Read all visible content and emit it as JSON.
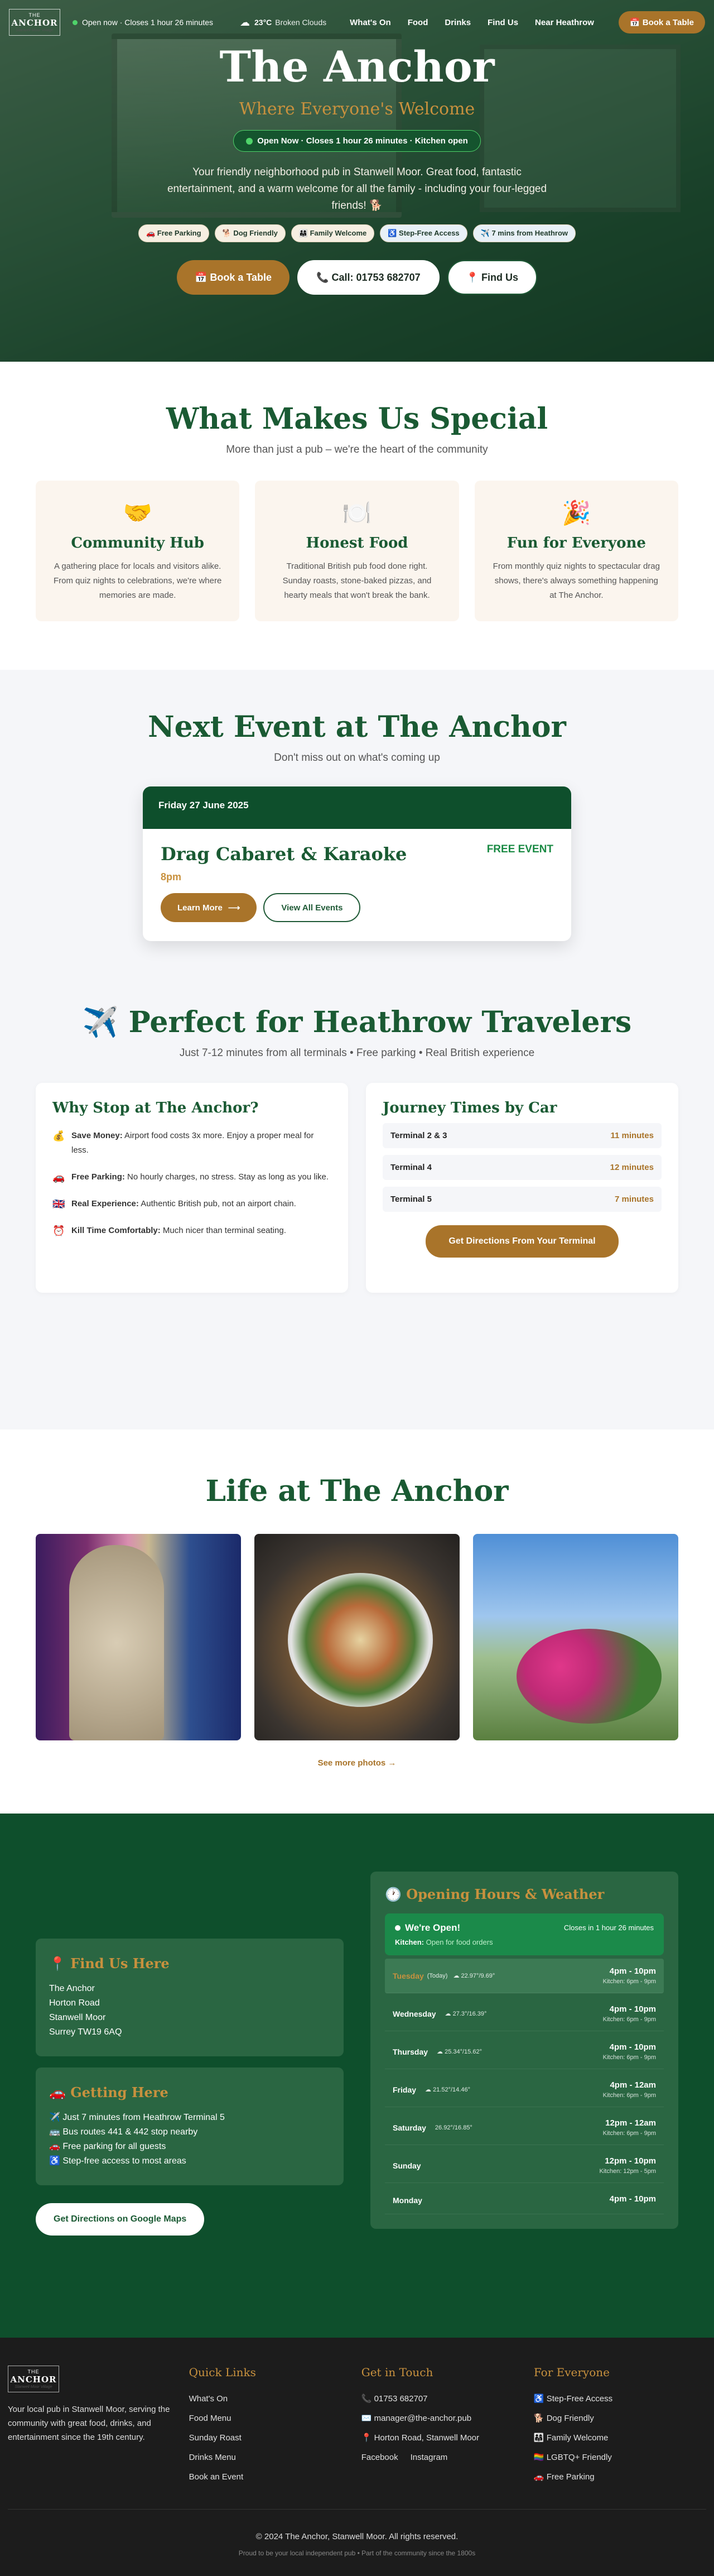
{
  "nav": {
    "logo_top": "THE",
    "logo_name": "ANCHOR",
    "logo_sub": "Stanwell Moor Village",
    "status": "Open now · Closes 1 hour 26 minutes",
    "weather_temp": "23°C",
    "weather_desc": "Broken Clouds",
    "links": [
      "What's On",
      "Food",
      "Drinks",
      "Find Us",
      "Near Heathrow"
    ],
    "book": "📅 Book a Table"
  },
  "hero": {
    "title": "The Anchor",
    "tagline": "Where Everyone's Welcome",
    "status_pill": "Open Now · Closes 1 hour 26 minutes · Kitchen open",
    "intro": "Your friendly neighborhood pub in Stanwell Moor. Great food, fantastic entertainment, and a warm welcome for all the family - including your four-legged friends! 🐕",
    "badges": [
      "🚗 Free Parking",
      "🐕 Dog Friendly",
      "👨‍👩‍👧 Family Welcome",
      "♿ Step-Free Access",
      "✈️ 7 mins from Heathrow"
    ],
    "cta_book": "📅 Book a Table",
    "cta_call": "📞 Call: 01753 682707",
    "cta_find": "📍 Find Us"
  },
  "special": {
    "title": "What Makes Us Special",
    "subtitle": "More than just a pub – we're the heart of the community",
    "cards": [
      {
        "icon": "🤝",
        "title": "Community Hub",
        "text": "A gathering place for locals and visitors alike. From quiz nights to celebrations, we're where memories are made."
      },
      {
        "icon": "🍽️",
        "title": "Honest Food",
        "text": "Traditional British pub food done right. Sunday roasts, stone-baked pizzas, and hearty meals that won't break the bank."
      },
      {
        "icon": "🎉",
        "title": "Fun for Everyone",
        "text": "From monthly quiz nights to spectacular drag shows, there's always something happening at The Anchor."
      }
    ]
  },
  "event": {
    "title": "Next Event at The Anchor",
    "subtitle": "Don't miss out on what's coming up",
    "date": "Friday 27 June 2025",
    "name": "Drag Cabaret & Karaoke",
    "time": "8pm",
    "price": "FREE EVENT",
    "learn": "Learn More",
    "all": "View All Events"
  },
  "heathrow": {
    "title": "✈️ Perfect for Heathrow Travelers",
    "subtitle": "Just 7-12 minutes from all terminals • Free parking • Real British experience",
    "why_title": "Why Stop at The Anchor?",
    "reasons": [
      {
        "icon": "💰",
        "bold": "Save Money:",
        "text": " Airport food costs 3x more. Enjoy a proper meal for less."
      },
      {
        "icon": "🚗",
        "bold": "Free Parking:",
        "text": " No hourly charges, no stress. Stay as long as you like."
      },
      {
        "icon": "🇬🇧",
        "bold": "Real Experience:",
        "text": " Authentic British pub, not an airport chain."
      },
      {
        "icon": "⏰",
        "bold": "Kill Time Comfortably:",
        "text": " Much nicer than terminal seating."
      }
    ],
    "journey_title": "Journey Times by Car",
    "journeys": [
      {
        "terminal": "Terminal 2 & 3",
        "time": "11 minutes"
      },
      {
        "terminal": "Terminal 4",
        "time": "12 minutes"
      },
      {
        "terminal": "Terminal 5",
        "time": "7 minutes"
      }
    ],
    "directions": "Get Directions From Your Terminal"
  },
  "life": {
    "title": "Life at The Anchor",
    "more": "See more photos →"
  },
  "info": {
    "find_title": "📍 Find Us Here",
    "address": [
      "The Anchor",
      "Horton Road",
      "Stanwell Moor",
      "Surrey TW19 6AQ"
    ],
    "getting_title": "🚗 Getting Here",
    "getting": [
      "✈️ Just 7 minutes from Heathrow Terminal 5",
      "🚌 Bus routes 441 & 442 stop nearby",
      "🚗 Free parking for all guests",
      "♿ Step-free access to most areas"
    ],
    "gmaps": "Get Directions on Google Maps",
    "hours_title": "🕐 Opening Hours & Weather",
    "open_title": "We're Open!",
    "open_closes": "Closes in 1 hour 26 minutes",
    "kitchen_label": "Kitchen:",
    "kitchen_status": "Open for food orders",
    "days": [
      {
        "day": "Tuesday",
        "note": "(Today)",
        "weather": "☁ 22.97°/9.69°",
        "hours": "4pm - 10pm",
        "kitchen": "Kitchen: 6pm - 9pm",
        "today": true
      },
      {
        "day": "Wednesday",
        "note": "",
        "weather": "☁ 27.3°/16.39°",
        "hours": "4pm - 10pm",
        "kitchen": "Kitchen: 6pm - 9pm",
        "today": false
      },
      {
        "day": "Thursday",
        "note": "",
        "weather": "☁ 25.34°/15.62°",
        "hours": "4pm - 10pm",
        "kitchen": "Kitchen: 6pm - 9pm",
        "today": false
      },
      {
        "day": "Friday",
        "note": "",
        "weather": "☁ 21.52°/14.46°",
        "hours": "4pm - 12am",
        "kitchen": "Kitchen: 6pm - 9pm",
        "today": false
      },
      {
        "day": "Saturday",
        "note": "",
        "weather": "26.92°/16.85°",
        "hours": "12pm - 12am",
        "kitchen": "Kitchen: 6pm - 9pm",
        "today": false
      },
      {
        "day": "Sunday",
        "note": "",
        "weather": "",
        "hours": "12pm - 10pm",
        "kitchen": "Kitchen: 12pm - 5pm",
        "today": false
      },
      {
        "day": "Monday",
        "note": "",
        "weather": "",
        "hours": "4pm - 10pm",
        "kitchen": "",
        "today": false
      }
    ]
  },
  "footer": {
    "about": "Your local pub in Stanwell Moor, serving the community with great food, drinks, and entertainment since the 19th century.",
    "quick_title": "Quick Links",
    "quick": [
      "What's On",
      "Food Menu",
      "Sunday Roast",
      "Drinks Menu",
      "Book an Event"
    ],
    "touch_title": "Get in Touch",
    "phone": "📞 01753 682707",
    "email": "✉️ manager@the-anchor.pub",
    "address": "📍 Horton Road, Stanwell Moor",
    "social": [
      "Facebook",
      "Instagram"
    ],
    "everyone_title": "For Everyone",
    "everyone": [
      "♿ Step-Free Access",
      "🐕 Dog Friendly",
      "👨‍👩‍👧 Family Welcome",
      "🏳️‍🌈 LGBTQ+ Friendly",
      "🚗 Free Parking"
    ],
    "copyright": "© 2024 The Anchor, Stanwell Moor. All rights reserved.",
    "tagline": "Proud to be your local independent pub • Part of the community since the 1800s"
  },
  "colors": {
    "green": "#0e4f2c",
    "gold": "#a9742a",
    "title_green": "#1a5a33"
  }
}
